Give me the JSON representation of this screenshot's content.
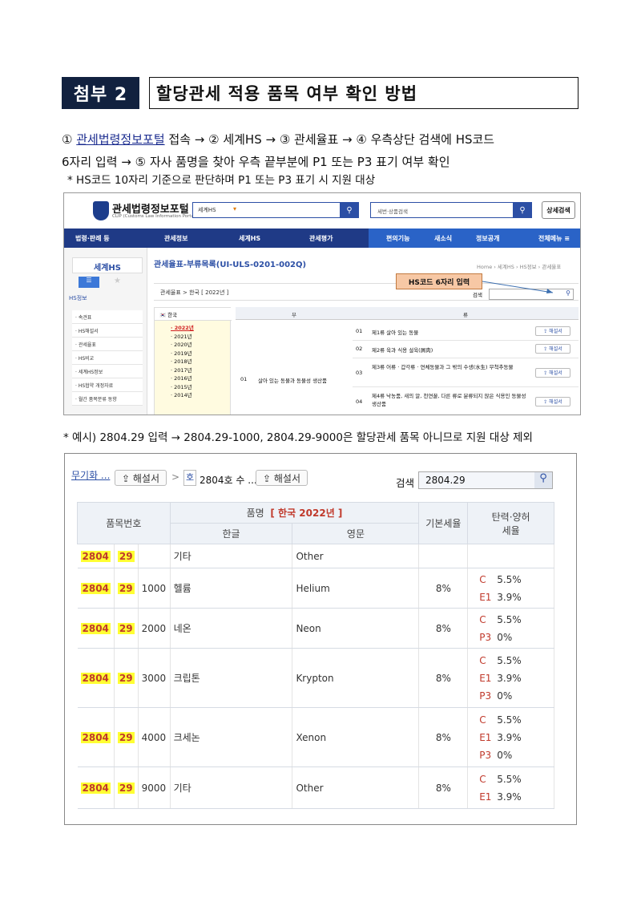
{
  "header": {
    "badge": "첨부 2",
    "title": "할당관세 적용 품목 여부 확인 방법"
  },
  "steps": {
    "s1": "①",
    "s1_link": "관세법령정보포털",
    "s1_rest": " 접속 → ② 세계HS → ③ 관세율표 → ④ 우측상단 검색에 HS코드",
    "line2": "6자리 입력 → ⑤ 자사 품명을 찾아 우측 끝부분에 P1 또는 P3 표기 여부 확인",
    "note": "* HS코드 10자리 기준으로 판단하며 P1 또는 P3 표기 시 지원 대상"
  },
  "shot1": {
    "logo": "관세법령정보포털",
    "logo_sub": "CLIP (Customs Law Information Portal)",
    "search1_select": "세계HS",
    "search2_placeholder": "세번·상품검색",
    "detail_btn": "상세검색",
    "nav": [
      "법령·판례 등",
      "관세정보",
      "세계HS",
      "관세평가",
      "편의기능",
      "새소식",
      "정보공개",
      "전체메뉴 ≡"
    ],
    "side_head": "세계HS",
    "side_info": "HS정보",
    "side_items": [
      "· 속견표",
      "· HS해설서",
      "· 관세율표",
      "· HS비교",
      "· 세계HS정보",
      "· HS협약 개정자료",
      "· 월간 품목분류 동향"
    ],
    "main_title": "관세율표-부류목록(UI-ULS-0201-002Q)",
    "breadcrumb": "Home › 세계HS › HS정보 › 관세율표",
    "sub_path": "관세율표 > 한국 [ 2022년 ]",
    "search_label": "검색",
    "callout": "HS코드 6자리 입력",
    "country": "한국",
    "years": [
      "· 2022년",
      "· 2021년",
      "· 2020년",
      "· 2019년",
      "· 2018년",
      "· 2017년",
      "· 2016년",
      "· 2015년",
      "· 2014년"
    ],
    "col_bu": "부",
    "col_ryu": "류",
    "bu_no": "01",
    "bu_name": "살아 있는 동물과 동물성 생산품",
    "rows": [
      {
        "no": "01",
        "name": "제1류 살아 있는 동물",
        "btn": "⇪ 해설서"
      },
      {
        "no": "02",
        "name": "제2류 육과 식용 설육(屑肉)",
        "btn": "⇪ 해설서"
      },
      {
        "no": "03",
        "name": "제3류 어류 · 갑각류 · 연체동물과 그 밖의 수생(水生) 무척추동물",
        "btn": "⇪ 해설서"
      },
      {
        "no": "04",
        "name": "제4류 낙농품, 새의 알, 천연꿀, 다른 류로 분류되지 않은 식용인 동물성 생산품",
        "btn": "⇪ 해설서"
      }
    ]
  },
  "example": "* 예시) 2804.29 입력 → 2804.29-1000, 2804.29-9000은 할당관세 품목 아니므로 지원 대상 제외",
  "shot2": {
    "crumb_link": "무기화 ...",
    "chip1": "⇪ 해설서",
    "sep": ">",
    "hbox": "호",
    "crumb2": "2804호 수 ...",
    "chip2": "⇪ 해설서",
    "search_label": "검색",
    "search_value": "2804.29",
    "th_code": "품목번호",
    "th_name_prefix": "품명",
    "th_name_country": "[ 한국  2022년 ]",
    "th_kor": "한글",
    "th_eng": "영문",
    "th_base": "기본세율",
    "th_flex1": "탄력·양허",
    "th_flex2": "세율",
    "rows": [
      {
        "c1": "2804",
        "c2": "29",
        "c3": "",
        "kor": "기타",
        "eng": "Other",
        "base": "",
        "rates": []
      },
      {
        "c1": "2804",
        "c2": "29",
        "c3": "1000",
        "kor": "헬륨",
        "eng": "Helium",
        "base": "8%",
        "rates": [
          [
            "C",
            "5.5%"
          ],
          [
            "E1",
            "3.9%"
          ]
        ]
      },
      {
        "c1": "2804",
        "c2": "29",
        "c3": "2000",
        "kor": "네온",
        "eng": "Neon",
        "base": "8%",
        "rates": [
          [
            "C",
            "5.5%"
          ],
          [
            "P3",
            "0%"
          ]
        ]
      },
      {
        "c1": "2804",
        "c2": "29",
        "c3": "3000",
        "kor": "크립톤",
        "eng": "Krypton",
        "base": "8%",
        "rates": [
          [
            "C",
            "5.5%"
          ],
          [
            "E1",
            "3.9%"
          ],
          [
            "P3",
            "0%"
          ]
        ]
      },
      {
        "c1": "2804",
        "c2": "29",
        "c3": "4000",
        "kor": "크세논",
        "eng": "Xenon",
        "base": "8%",
        "rates": [
          [
            "C",
            "5.5%"
          ],
          [
            "E1",
            "3.9%"
          ],
          [
            "P3",
            "0%"
          ]
        ]
      },
      {
        "c1": "2804",
        "c2": "29",
        "c3": "9000",
        "kor": "기타",
        "eng": "Other",
        "base": "8%",
        "rates": [
          [
            "C",
            "5.5%"
          ],
          [
            "E1",
            "3.9%"
          ]
        ]
      }
    ]
  }
}
